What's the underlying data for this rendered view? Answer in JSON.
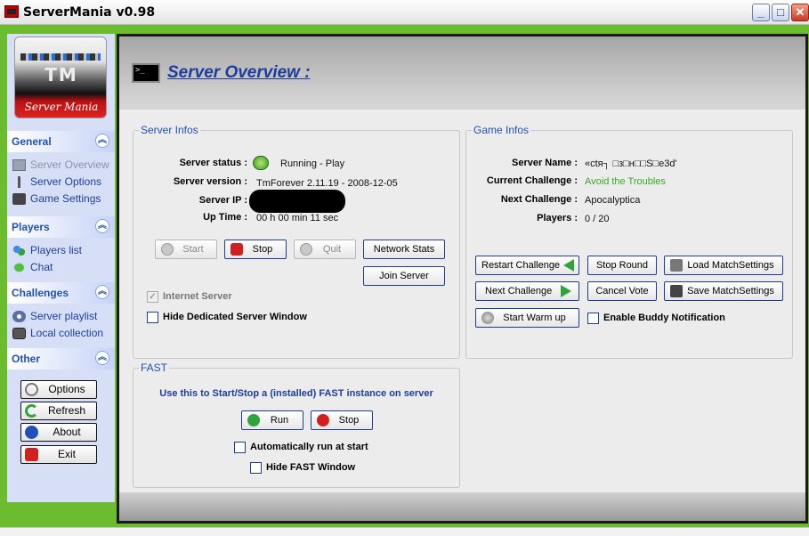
{
  "window": {
    "title": "ServerMania v0.98",
    "minimize": "_",
    "maximize": "□",
    "close": "✕"
  },
  "sidebar": {
    "logo_caption": "Server Mania",
    "logo_big": "TM",
    "sections": [
      {
        "title": "General",
        "items": [
          "Server Overview",
          "Server Options",
          "Game Settings"
        ]
      },
      {
        "title": "Players",
        "items": [
          "Players list",
          "Chat"
        ]
      },
      {
        "title": "Challenges",
        "items": [
          "Server playlist",
          "Local collection"
        ]
      },
      {
        "title": "Other",
        "buttons": [
          "Options",
          "Refresh",
          "About",
          "Exit"
        ]
      }
    ],
    "collapse_glyph": "︽"
  },
  "main": {
    "title": "Server Overview :",
    "terminal_glyph": ">_",
    "server_infos": {
      "label": "Server Infos",
      "status_label": "Server status :",
      "status_value": "Running - Play",
      "version_label": "Server version :",
      "version_value": "TmForever 2.11.19 - 2008-12-05",
      "ip_label": "Server IP :",
      "ip_value": "",
      "uptime_label": "Up Time :",
      "uptime_value": "00 h 00 min 11 sec",
      "buttons": {
        "start": "Start",
        "stop": "Stop",
        "quit": "Quit",
        "network_stats": "Network Stats",
        "join_server": "Join Server"
      },
      "internet_server": "Internet Server",
      "hide_window": "Hide Dedicated Server Window"
    },
    "game_infos": {
      "label": "Game Infos",
      "server_name_label": "Server Name :",
      "server_name_value": "«ctя┐ □з□н□□S□e3d'",
      "current_label": "Current Challenge :",
      "current_value": "Avoid the Troubles",
      "next_label": "Next Challenge :",
      "next_value": "Apocalyptica",
      "players_label": "Players :",
      "players_value": "0 / 20",
      "buttons": {
        "restart": "Restart Challenge",
        "stop_round": "Stop Round",
        "load_match": "Load MatchSettings",
        "next": "Next Challenge",
        "cancel_vote": "Cancel Vote",
        "save_match": "Save MatchSettings",
        "warm_up": "Start Warm up"
      },
      "buddy": "Enable Buddy Notification"
    },
    "fast": {
      "label": "FAST",
      "description": "Use this to Start/Stop a (installed) FAST instance on server",
      "run": "Run",
      "stop": "Stop",
      "auto_run": "Automatically run at start",
      "hide_window": "Hide FAST Window"
    }
  },
  "colors": {
    "accent": "#2150b9",
    "frame": "#6bbd2f",
    "green_text": "#3aa52a"
  }
}
